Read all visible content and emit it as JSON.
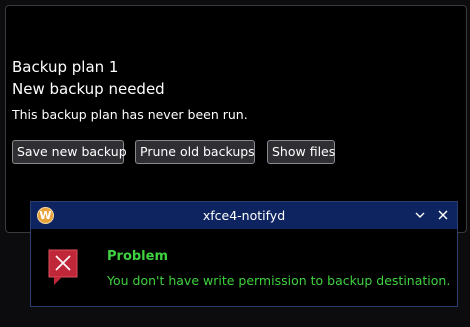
{
  "backup_plan": {
    "title": "Backup plan 1",
    "status": "New backup needed",
    "description": "This backup plan has never been run.",
    "buttons": {
      "save": "Save new backup",
      "prune": "Prune old backups",
      "show": "Show files"
    }
  },
  "notification": {
    "app_logo_letter": "W",
    "app_logo_icon": "wallet-logo-icon",
    "title": "xfce4-notifyd",
    "collapse_icon": "chevron-down-icon",
    "close_icon": "close-icon",
    "status_icon": "error-dialog-icon",
    "summary": "Problem",
    "body": "You don't have write permission to backup destination.",
    "colors": {
      "titlebar": "#0e2460",
      "text_accent": "#3fd13f",
      "error_icon": "#c0283a"
    }
  }
}
